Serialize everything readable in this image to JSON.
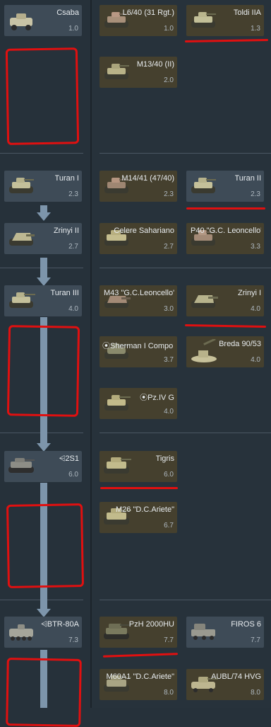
{
  "rows": [
    {
      "name": "rank-row-1",
      "left": {
        "name": "Csaba",
        "br": "1.0",
        "style": "blue"
      },
      "right": [
        {
          "name": "L6/40 (31 Rgt.)",
          "br": "1.0",
          "style": "tan"
        },
        {
          "name": "Toldi IIA",
          "br": "1.3",
          "style": "tan"
        },
        {
          "name": "M13/40 (II)",
          "br": "2.0",
          "style": "tan"
        }
      ]
    },
    {
      "name": "rank-row-2",
      "left": {
        "name": "Turan I",
        "br": "2.3",
        "style": "blue"
      },
      "right": [
        {
          "name": "M14/41 (47/40)",
          "br": "2.3",
          "style": "tan"
        },
        {
          "name": "Turan II",
          "br": "2.3",
          "style": "blue"
        }
      ]
    },
    {
      "name": "rank-row-3",
      "left": {
        "name": "Zrinyi II",
        "br": "2.7",
        "style": "blue"
      },
      "right": [
        {
          "name": "Celere Sahariano",
          "br": "2.7",
          "style": "tan"
        },
        {
          "name": "P40 \"G.C. Leoncello\"",
          "br": "3.3",
          "style": "tan"
        }
      ]
    },
    {
      "name": "rank-row-4",
      "left": {
        "name": "Turan III",
        "br": "4.0",
        "style": "blue"
      },
      "right": [
        {
          "name": "M43 \"G.C.Leoncello\"",
          "br": "3.0",
          "style": "tan"
        },
        {
          "name": "Zrinyi I",
          "br": "4.0",
          "style": "tan"
        },
        {
          "name": "Sherman I Composito",
          "br": "3.7",
          "style": "tan"
        },
        {
          "name": "Breda 90/53",
          "br": "4.0",
          "style": "tan"
        },
        {
          "name": "Pz.IV G",
          "br": "4.0",
          "style": "tan"
        }
      ]
    },
    {
      "name": "rank-row-5",
      "left": {
        "name": "2S1",
        "br": "6.0",
        "style": "blue"
      },
      "right": [
        {
          "name": "Tigris",
          "br": "6.0",
          "style": "tan"
        },
        {
          "name": "M26 \"D.C.Ariete\"",
          "br": "6.7",
          "style": "tan"
        }
      ]
    },
    {
      "name": "rank-row-6",
      "left": {
        "name": "BTR-80A",
        "br": "7.3",
        "style": "blue"
      },
      "right": [
        {
          "name": "PzH 2000HU",
          "br": "7.7",
          "style": "tan"
        },
        {
          "name": "FIROS 6",
          "br": "7.7",
          "style": "blue"
        },
        {
          "name": "M60A1 \"D.C.Ariete\"",
          "br": "8.0",
          "style": "tan"
        },
        {
          "name": "AUBL/74 HVG",
          "br": "8.0",
          "style": "tan"
        }
      ]
    }
  ]
}
